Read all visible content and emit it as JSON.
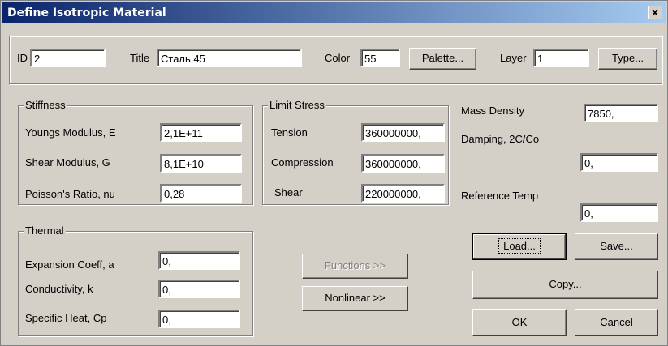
{
  "window": {
    "title": "Define Isotropic Material",
    "close_glyph": "x"
  },
  "header": {
    "id_label": "ID",
    "id_value": "2",
    "title_label": "Title",
    "title_value": "Сталь 45",
    "color_label": "Color",
    "color_value": "55",
    "palette_button": "Palette...",
    "layer_label": "Layer",
    "layer_value": "1",
    "type_button": "Type..."
  },
  "stiffness": {
    "group_title": "Stiffness",
    "rows": [
      {
        "label": "Youngs Modulus, E",
        "value": "2,1E+11"
      },
      {
        "label": "Shear Modulus, G",
        "value": "8,1E+10"
      },
      {
        "label": "Poisson's Ratio, nu",
        "value": "0,28"
      }
    ]
  },
  "limit_stress": {
    "group_title": "Limit Stress",
    "rows": [
      {
        "label": "Tension",
        "value": "360000000,"
      },
      {
        "label": "Compression",
        "value": "360000000,"
      },
      {
        "label": "Shear",
        "value": "220000000,"
      }
    ]
  },
  "right_panel": {
    "mass_density_label": "Mass Density",
    "mass_density_value": "7850,",
    "damping_label": "Damping, 2C/Co",
    "damping_value": "0,",
    "reference_temp_label": "Reference Temp",
    "reference_temp_value": "0,"
  },
  "thermal": {
    "group_title": "Thermal",
    "rows": [
      {
        "label": "Expansion Coeff, a",
        "value": "0,"
      },
      {
        "label": "Conductivity, k",
        "value": "0,"
      },
      {
        "label": "Specific Heat, Cp",
        "value": "0,"
      }
    ]
  },
  "buttons": {
    "functions": "Functions >>",
    "nonlinear": "Nonlinear >>",
    "load": "Load...",
    "save": "Save...",
    "copy": "Copy...",
    "ok": "OK",
    "cancel": "Cancel"
  },
  "colors": {
    "face": "#d4d0c8",
    "title_start": "#0a246a",
    "title_end": "#a6caf0"
  }
}
